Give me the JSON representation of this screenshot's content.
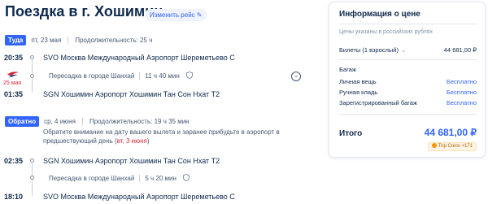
{
  "page": {
    "title": "Поездка в г. Хошимин",
    "change_label": "Изменить рейс",
    "pen_icon": "✎"
  },
  "outbound": {
    "badge": "Туда",
    "date": "пт, 23 мая",
    "duration": "Продолжительность: 25 ч",
    "dep_time": "20:35",
    "dep_airport": "SVO Москва Международный Аэропорт Шереметьево C",
    "airline_date": "25 мая",
    "transfer_text": "Пересадка в городе Шанхай",
    "transfer_duration": "11 ч 40 мин",
    "arr_time": "01:35",
    "arr_airport": "SGN Хошимин Аэропорт Хошимин Тан Сон Нхат T2"
  },
  "return": {
    "badge": "Обратно",
    "date": "ср, 4 июня",
    "duration": "Продолжительность: 19 ч 35 мин",
    "notice_text": "Обратите внимание на дату вашего вылета и заранее прибудьте в аэропорт в предшествующий день (",
    "notice_date": "вт, 3 июня",
    "notice_end": ")",
    "dep_time": "02:35",
    "dep_airport": "SGN Хошимин Аэропорт Хошимин Тан Сон Нхат T2",
    "transfer_text": "Пересадка в городе Шанхай",
    "transfer_duration": "5 ч 20 мин",
    "arr_time": "18:10",
    "arr_airport": "SVO Москва Международный Аэропорт Шереметьево C"
  },
  "price": {
    "title": "Информация о цене",
    "subtitle": "Цены указаны в российских рублях",
    "tickets_label": "Билеты (1 взрослый)",
    "tickets_value": "44 681,00 ₽",
    "baggage_title": "Багаж",
    "personal_label": "Личная вещь",
    "personal_value": "Бесплатно",
    "carryon_label": "Ручная кладь",
    "carryon_value": "Бесплатно",
    "checked_label": "Зарегистрированный багаж",
    "checked_value": "Бесплатно",
    "total_label": "Итого",
    "total_value": "44 681,00 ₽",
    "coins_label": "Trip Coins +171"
  },
  "colors": {
    "accent": "#3264ff",
    "text": "#0f294d",
    "warning": "#e02d3c"
  }
}
